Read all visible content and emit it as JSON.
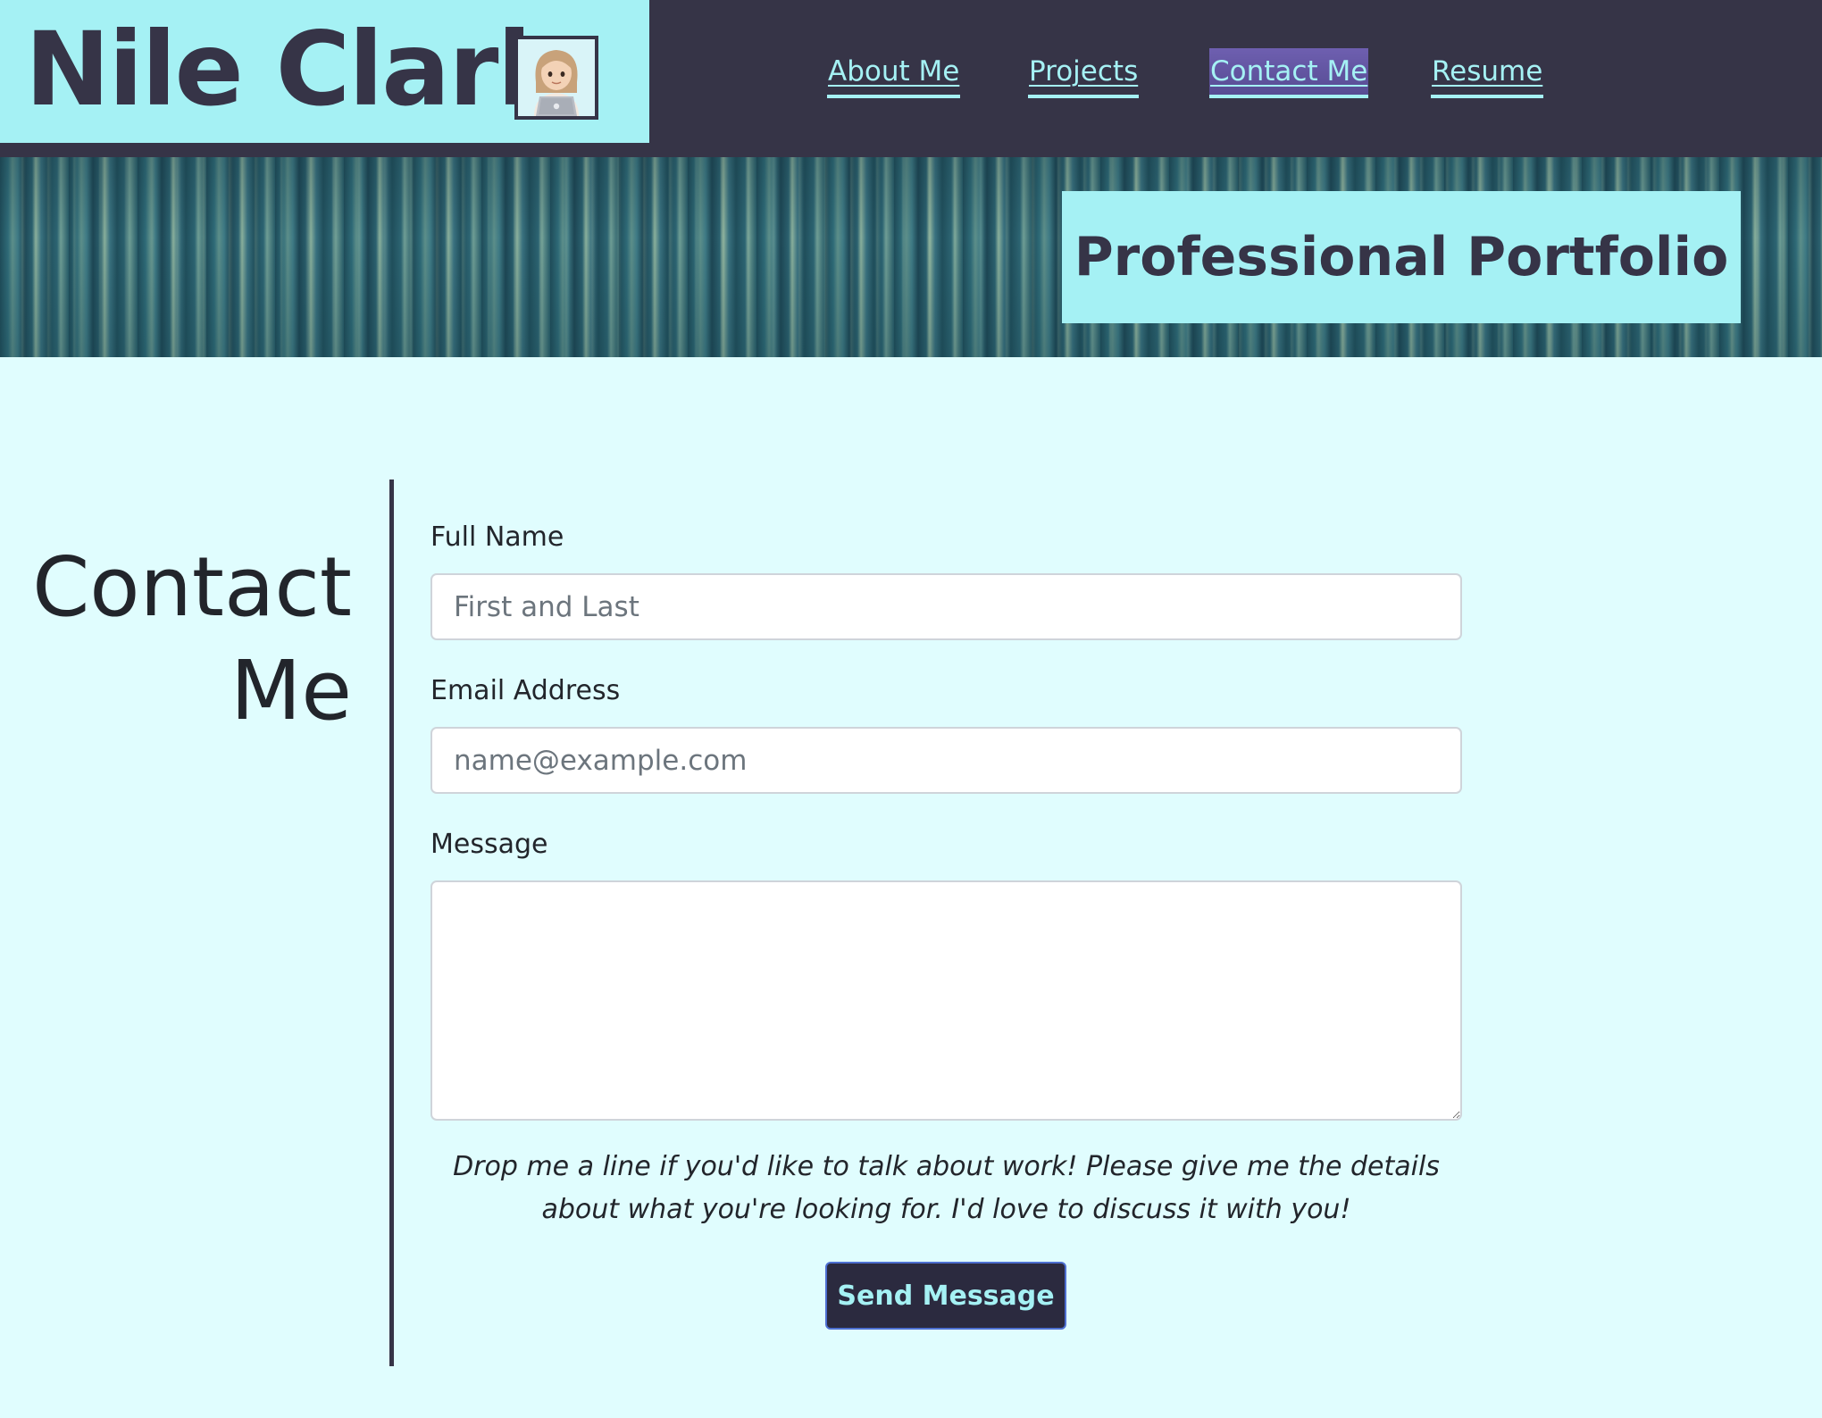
{
  "header": {
    "brand_name": "Nile Clark",
    "avatar_icon": "woman-technologist-emoji-icon",
    "nav": [
      {
        "label": "About Me",
        "active": false
      },
      {
        "label": "Projects",
        "active": false
      },
      {
        "label": "Contact Me",
        "active": true
      },
      {
        "label": "Resume",
        "active": false
      }
    ]
  },
  "banner": {
    "title": "Professional Portfolio"
  },
  "contact": {
    "heading": "Contact Me",
    "form": {
      "full_name": {
        "label": "Full Name",
        "placeholder": "First and Last",
        "value": ""
      },
      "email": {
        "label": "Email Address",
        "placeholder": "name@example.com",
        "value": ""
      },
      "message": {
        "label": "Message",
        "value": ""
      },
      "note": "Drop me a line if you'd like to talk about work! Please give me the details about what you're looking for. I'd love to discuss it with you!",
      "submit_label": "Send Message"
    }
  },
  "colors": {
    "page_background": "#e0fdfe",
    "header_dark": "#363447",
    "accent_cyan": "#a5f1f4",
    "active_link_highlight": "#6e5fb0",
    "button_border": "#4d6fd1"
  }
}
